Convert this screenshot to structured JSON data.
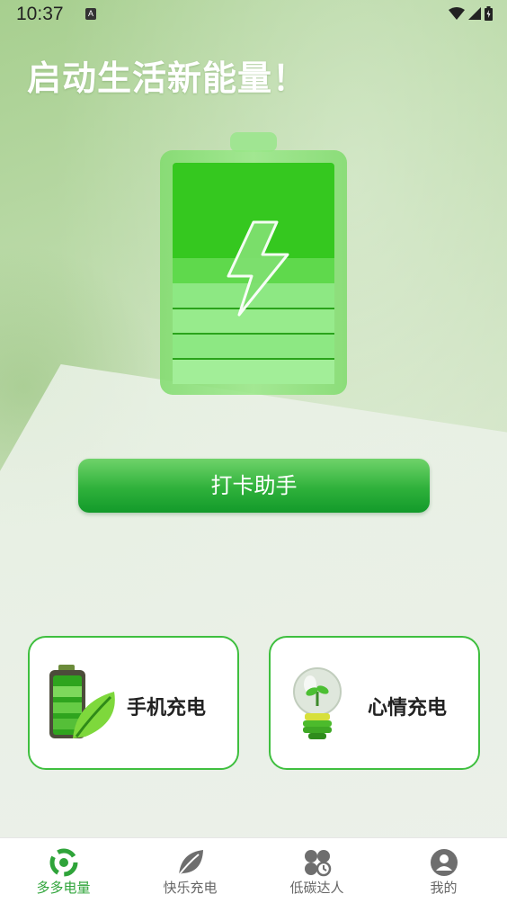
{
  "status_bar": {
    "time": "10:37",
    "notification_letter": "A"
  },
  "headline": "启动生活新能量！",
  "battery_illustration": {
    "icon": "battery-charging-icon",
    "color": "#3fcd2b"
  },
  "checkin_button": {
    "label": "打卡助手"
  },
  "cards": [
    {
      "label": "手机充电",
      "icon": "phone-battery-leaf-icon"
    },
    {
      "label": "心情充电",
      "icon": "lightbulb-sprout-icon"
    }
  ],
  "bottom_nav": {
    "items": [
      {
        "label": "多多电量",
        "icon": "power-ring-icon",
        "active": true
      },
      {
        "label": "快乐充电",
        "icon": "leaf-icon",
        "active": false
      },
      {
        "label": "低碳达人",
        "icon": "clover-icon",
        "active": false
      },
      {
        "label": "我的",
        "icon": "user-icon",
        "active": false
      }
    ]
  },
  "colors": {
    "accent": "#2fa43a",
    "card_border": "#3fbf3f",
    "button": "#2fb13b"
  }
}
